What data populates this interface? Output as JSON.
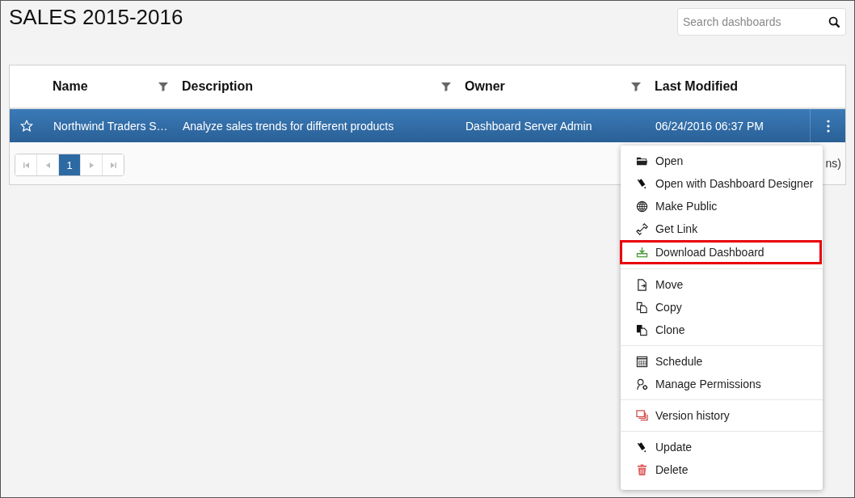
{
  "title": "SALES 2015-2016",
  "search": {
    "placeholder": "Search dashboards"
  },
  "table": {
    "columns": [
      {
        "label": "Name",
        "filterable": true
      },
      {
        "label": "Description",
        "filterable": true
      },
      {
        "label": "Owner",
        "filterable": true
      },
      {
        "label": "Last Modified",
        "filterable": false
      }
    ],
    "rows": [
      {
        "selected": true,
        "starred": false,
        "cells": [
          "Northwind Traders S…",
          "Analyze sales trends for different products",
          "Dashboard Server Admin",
          "06/24/2016 06:37 PM"
        ]
      }
    ]
  },
  "pager": {
    "pages": [
      {
        "label": "1",
        "selected": true
      }
    ],
    "info": "ns)"
  },
  "context_menu": {
    "groups": [
      {
        "items": [
          {
            "kind": "folder",
            "label": "Open",
            "highlighted": false
          },
          {
            "kind": "pen",
            "label": "Open with Dashboard Designer",
            "highlighted": false
          },
          {
            "kind": "globe",
            "label": "Make Public",
            "highlighted": false
          },
          {
            "kind": "link",
            "label": "Get Link",
            "highlighted": false
          },
          {
            "kind": "download",
            "label": "Download Dashboard",
            "highlighted": true
          }
        ]
      },
      {
        "items": [
          {
            "kind": "move",
            "label": "Move",
            "highlighted": false
          },
          {
            "kind": "copy",
            "label": "Copy",
            "highlighted": false
          },
          {
            "kind": "clone",
            "label": "Clone",
            "highlighted": false
          }
        ]
      },
      {
        "items": [
          {
            "kind": "calendar",
            "label": "Schedule",
            "highlighted": false
          },
          {
            "kind": "permissions",
            "label": "Manage Permissions",
            "highlighted": false
          }
        ]
      },
      {
        "items": [
          {
            "kind": "versions",
            "label": "Version history",
            "highlighted": false
          }
        ]
      },
      {
        "items": [
          {
            "kind": "pen",
            "label": "Update",
            "highlighted": false
          },
          {
            "kind": "trash",
            "label": "Delete",
            "highlighted": false
          }
        ]
      }
    ]
  }
}
